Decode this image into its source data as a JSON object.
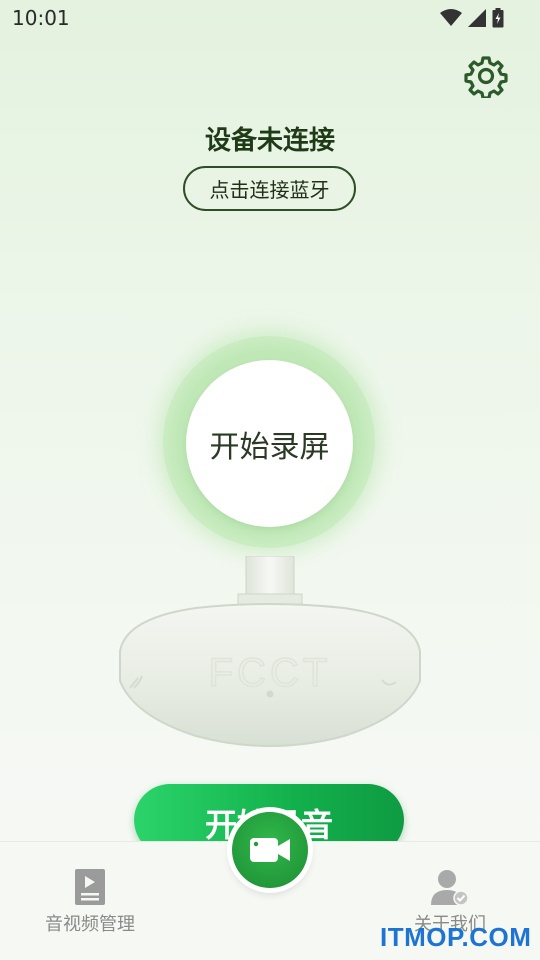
{
  "status_bar": {
    "time": "10:01",
    "icons": [
      "wifi-icon",
      "signal-icon",
      "battery-charging-icon"
    ]
  },
  "header": {
    "settings_icon": "gear-icon"
  },
  "device": {
    "status": "设备未连接",
    "connect_label": "点击连接蓝牙"
  },
  "record_screen": {
    "label": "开始录屏"
  },
  "illustration": {
    "logo_text": "FCCT"
  },
  "record_audio": {
    "label": "开始录音"
  },
  "bottom_nav": {
    "left": {
      "label": "音视频管理",
      "icon": "media-file-icon"
    },
    "center": {
      "icon": "video-camera-icon"
    },
    "right": {
      "label": "关于我们",
      "icon": "user-check-icon"
    }
  },
  "watermark": {
    "text": "ITMOP.COM"
  },
  "colors": {
    "accent_green": "#239a3b",
    "dark_green": "#1f3a16",
    "watermark_blue": "#1e74d3"
  }
}
